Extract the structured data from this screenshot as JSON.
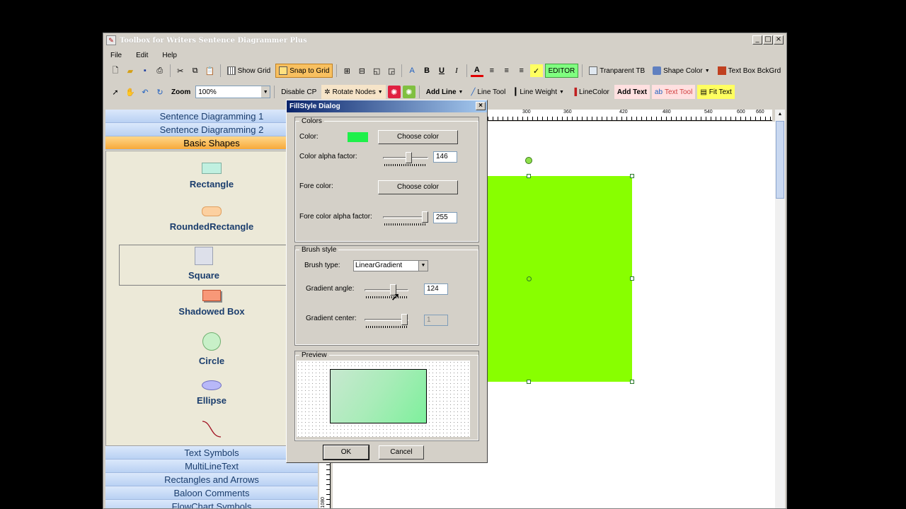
{
  "window": {
    "title": "Toolbox for Writers Sentence Diagrammer Plus",
    "controls": {
      "minimize": "_",
      "maximize": "□",
      "close": "×"
    }
  },
  "menubar": [
    "File",
    "Edit",
    "Help"
  ],
  "toolbar1": {
    "show_grid": "Show Grid",
    "snap_to_grid": "Snap to Grid",
    "editor": "EDITOR",
    "transparent_tb": "Tranparent TB",
    "shape_color": "Shape Color",
    "text_box_bkgrd": "Text Box BckGrd",
    "bold": "B",
    "underline": "U",
    "italic": "I",
    "font_color": "A"
  },
  "toolbar2": {
    "zoom_label": "Zoom",
    "zoom_value": "100%",
    "disable_cp": "Disable CP",
    "rotate_nodes": "Rotate Nodes",
    "add_line": "Add Line",
    "line_tool": "Line Tool",
    "line_weight": "Line Weight",
    "line_color": "LineColor",
    "add_text": "Add Text",
    "text_tool": "Text Tool",
    "fit_text": "Fit Text"
  },
  "left_panel": {
    "categories_top": [
      "Sentence Diagramming 1",
      "Sentence Diagramming 2"
    ],
    "active_category": "Basic Shapes",
    "shapes": [
      "Rectangle",
      "RoundedRectangle",
      "Square",
      "Shadowed Box",
      "Circle",
      "Ellipse"
    ],
    "categories_bottom": [
      "Text Symbols",
      "MultiLineText",
      "Rectangles and Arrows",
      "Baloon Comments",
      "FlowChart Symbols"
    ]
  },
  "ruler": {
    "h_ticks": [
      "300",
      "360",
      "420",
      "480",
      "540",
      "600",
      "660"
    ],
    "v_tick": "1080"
  },
  "dialog": {
    "title": "FillStyle Dialog",
    "close": "×",
    "colors_group": "Colors",
    "color_label": "Color:",
    "color_value": "#1ef04a",
    "choose_color": "Choose color",
    "color_alpha_label": "Color alpha factor:",
    "color_alpha_value": "146",
    "fore_color_label": "Fore color:",
    "fore_color_value": "#d4d0c8",
    "choose_color2": "Choose color",
    "fore_alpha_label": "Fore color alpha factor:",
    "fore_alpha_value": "255",
    "brush_group": "Brush style",
    "brush_type_label": "Brush type:",
    "brush_type_value": "LinearGradient",
    "gradient_angle_label": "Gradient angle:",
    "gradient_angle_value": "124",
    "gradient_center_label": "Gradient center:",
    "gradient_center_value": "1",
    "preview_group": "Preview",
    "ok": "OK",
    "cancel": "Cancel"
  },
  "colors": {
    "shape_fill": "#88ff00",
    "accent_orange": "#f7a93a"
  }
}
